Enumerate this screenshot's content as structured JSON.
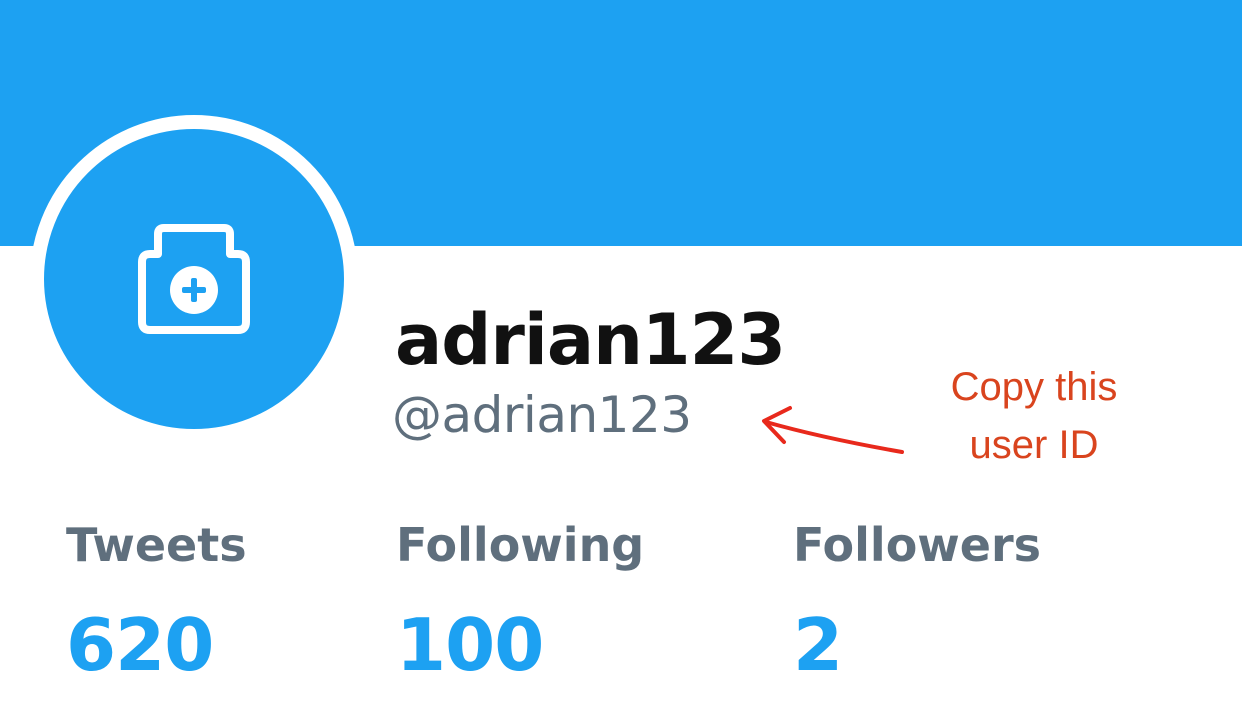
{
  "colors": {
    "brand": "#1da1f2",
    "name_text": "#111111",
    "secondary_text": "#5f6f7d",
    "annotation": "#d9441e"
  },
  "banner": {
    "color": "#1da1f2"
  },
  "avatar": {
    "icon": "camera-plus-icon"
  },
  "profile": {
    "display_name": "adrian123",
    "handle": "@adrian123"
  },
  "annotation": {
    "line1": "Copy this",
    "line2": "user ID",
    "icon": "arrow-left-icon"
  },
  "stats": {
    "tweets": {
      "label": "Tweets",
      "value": "620"
    },
    "following": {
      "label": "Following",
      "value": "100"
    },
    "followers": {
      "label": "Followers",
      "value": "2"
    }
  }
}
